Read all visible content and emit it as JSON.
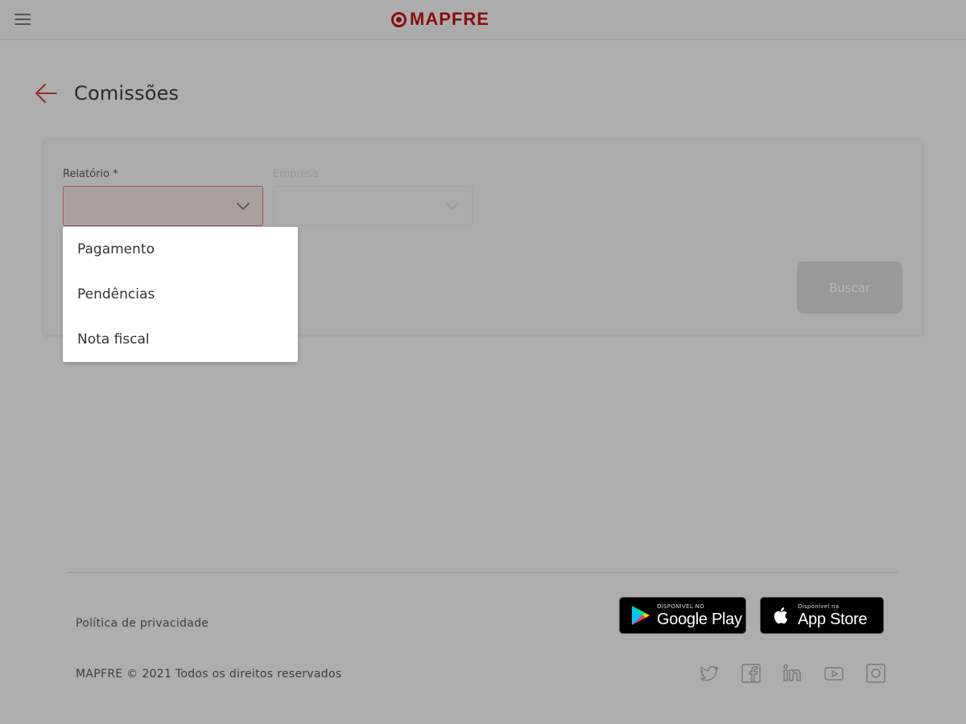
{
  "header": {
    "brand": "MAPFRE",
    "brand_color": "#8b0d0d"
  },
  "page": {
    "title": "Comissões"
  },
  "form": {
    "relatorio_label": "Relatório *",
    "relatorio_value": "",
    "empresa_label": "Empresa",
    "empresa_value": "",
    "search_button": "Buscar"
  },
  "dropdown": {
    "options": [
      "Pagamento",
      "Pendências",
      "Nota fiscal"
    ]
  },
  "footer": {
    "privacy": "Política de privacidade",
    "copyright": "MAPFRE © 2021 Todos os direitos reservados",
    "google_play_small": "DISPONÍVEL NO",
    "google_play_big": "Google Play",
    "app_store_small": "Disponível na",
    "app_store_big": "App Store",
    "social_icons": [
      "twitter-icon",
      "facebook-icon",
      "linkedin-icon",
      "youtube-icon",
      "instagram-icon"
    ]
  }
}
